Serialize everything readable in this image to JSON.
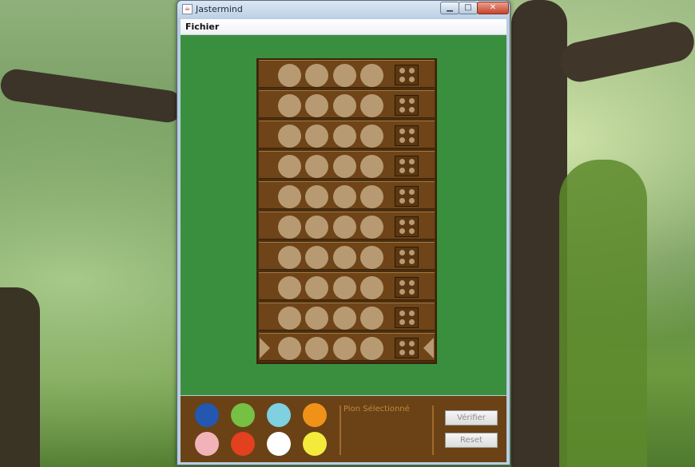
{
  "window": {
    "title": "Jastermind",
    "icon_glyph": "☕",
    "min_glyph": "▁",
    "max_glyph": "□",
    "close_glyph": "✕"
  },
  "menubar": {
    "items": [
      {
        "label": "Fichier"
      }
    ]
  },
  "board": {
    "row_count": 10,
    "pegs_per_row": 4,
    "empty_peg_color": "#b89a72",
    "row_color": "#6e4418",
    "current_row_index": 9
  },
  "palette": [
    {
      "name": "blue",
      "color": "#2357b0"
    },
    {
      "name": "green",
      "color": "#76c043"
    },
    {
      "name": "cyan",
      "color": "#7fd0e0"
    },
    {
      "name": "orange",
      "color": "#f0921a"
    },
    {
      "name": "pink",
      "color": "#f2b3b8"
    },
    {
      "name": "red",
      "color": "#e2401f"
    },
    {
      "name": "white",
      "color": "#ffffff"
    },
    {
      "name": "yellow",
      "color": "#f3ea3c"
    }
  ],
  "status": {
    "selected_label": "Pion Sélectionné"
  },
  "buttons": {
    "verify_label": "Vérifier",
    "reset_label": "Reset"
  },
  "colors": {
    "felt_green": "#3a8f3e",
    "panel_brown": "#6a4216"
  }
}
